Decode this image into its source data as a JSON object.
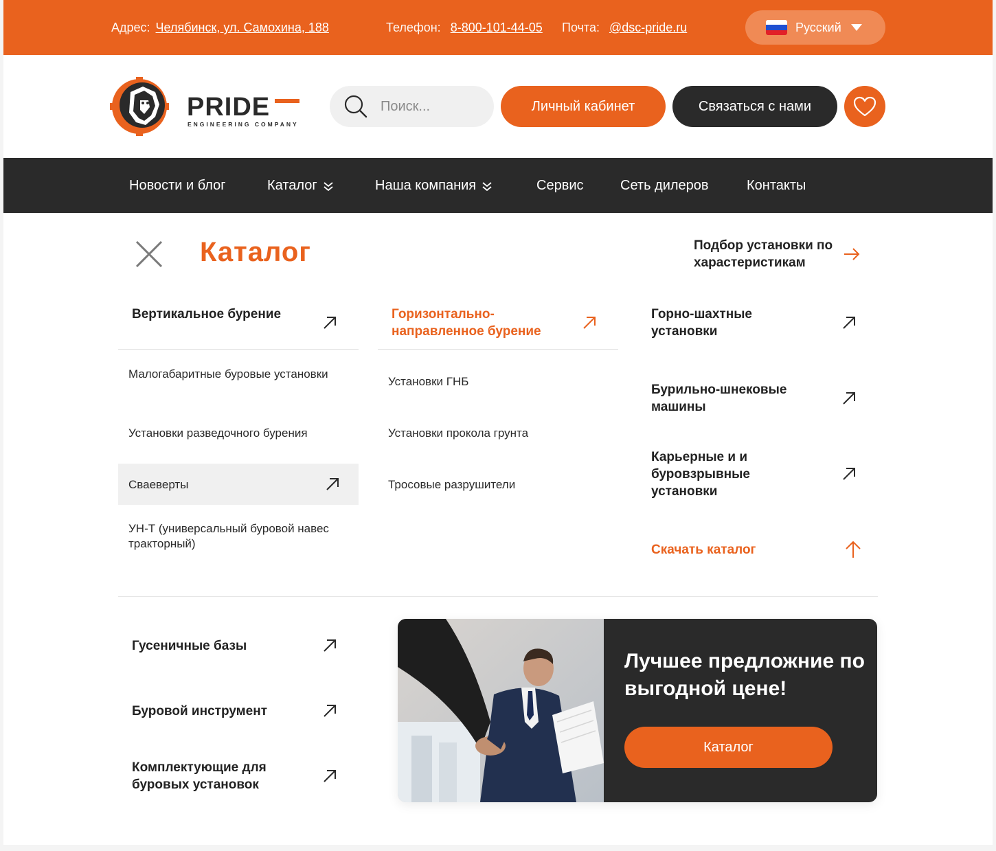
{
  "topbar": {
    "address_label": "Адрес:",
    "address_value": "Челябинск, ул. Самохина, 188",
    "phone_label": "Телефон:",
    "phone_value": "8-800-101-44-05",
    "email_label": "Почта:",
    "email_value": "@dsc-pride.ru",
    "language": "Русский"
  },
  "header": {
    "logo_text": "PRIDE",
    "logo_subtext": "ENGINEERING COMPANY",
    "search_placeholder": "Поиск...",
    "cabinet_label": "Личный кабинет",
    "contact_label": "Связаться с нами",
    "favorites_icon": "heart-icon"
  },
  "nav": {
    "items": [
      {
        "label": "Новости и блог"
      },
      {
        "label": "Каталог"
      },
      {
        "label": "Наша компания"
      },
      {
        "label": "Сервис"
      },
      {
        "label": "Сеть дилеров"
      },
      {
        "label": "Контакты"
      }
    ]
  },
  "catalog": {
    "title": "Каталог",
    "pick_label": "Подбор установки по харастеристикам",
    "columns": [
      {
        "heading": "Вертикальное бурение",
        "items": [
          "Малогабаритные буровые установки",
          "Установки разведочного бурения",
          "Сваеверты",
          "УН-Т (универсальный буровой навес тракторный)"
        ]
      },
      {
        "heading": "Горизонтально-направленное бурение",
        "items": [
          "Установки ГНБ",
          "Установки прокола грунта",
          "Тросовые разрушители"
        ]
      }
    ],
    "right_items": [
      "Горно-шахтные установки",
      "Бурильно-шнековые машины",
      "Карьерные и и буровзрывные установки"
    ],
    "download_label": "Скачать каталог",
    "bottom_items": [
      "Гусеничные базы",
      "Буровой инструмент",
      "Комплектующие для буровых установок"
    ]
  },
  "promo": {
    "text": "Лучшее предложние по выгодной цене!",
    "button_label": "Каталог"
  },
  "colors": {
    "accent": "#e9621e",
    "dark": "#2a2a2a"
  }
}
